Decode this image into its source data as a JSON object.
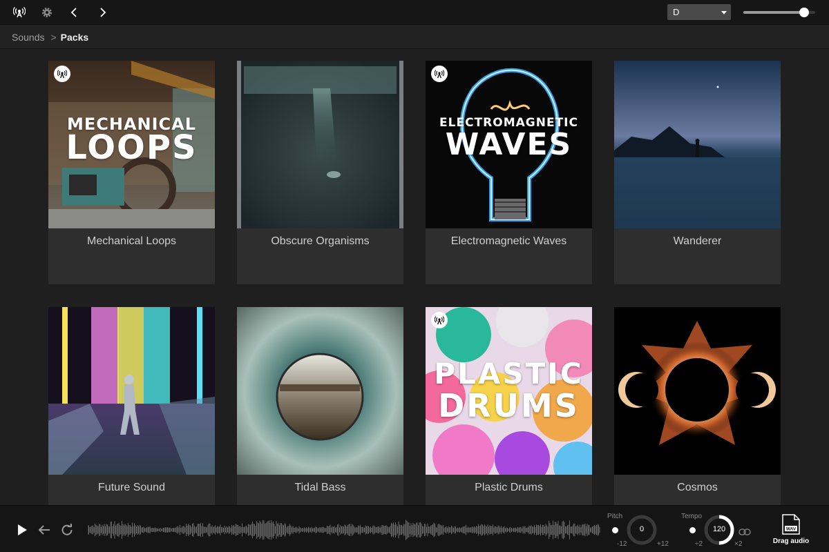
{
  "topbar": {
    "icons": [
      "broadcast-icon",
      "gear-icon",
      "chevron-left-icon",
      "chevron-right-icon"
    ],
    "key_value": "D",
    "volume": 0.85
  },
  "breadcrumb": {
    "root": "Sounds",
    "separator": ">",
    "current": "Packs"
  },
  "packs": [
    {
      "title": "Mechanical Loops",
      "art_line1": "MECHANICAL",
      "art_line2": "LOOPS",
      "badge": true
    },
    {
      "title": "Obscure Organisms",
      "art_line1": "",
      "art_line2": "",
      "badge": false
    },
    {
      "title": "Electromagnetic Waves",
      "art_line1": "ELECTROMAGNETIC",
      "art_line2": "WAVES",
      "badge": true
    },
    {
      "title": "Wanderer",
      "art_line1": "",
      "art_line2": "",
      "badge": false
    },
    {
      "title": "Future Sound",
      "art_line1": "",
      "art_line2": "",
      "badge": false
    },
    {
      "title": "Tidal Bass",
      "art_line1": "",
      "art_line2": "",
      "badge": false
    },
    {
      "title": "Plastic Drums",
      "art_line1": "PLASTIC",
      "art_line2": "DRUMS",
      "badge": true
    },
    {
      "title": "Cosmos",
      "art_line1": "",
      "art_line2": "",
      "badge": false
    }
  ],
  "player": {
    "pitch": {
      "label": "Pitch",
      "value": "0",
      "min": "-12",
      "max": "+12"
    },
    "tempo": {
      "label": "Tempo",
      "value": "120",
      "min": "÷2",
      "max": "×2",
      "level": 0.5
    },
    "file_type": "WAV",
    "drag_label": "Drag audio"
  },
  "colors": {
    "background": "#1f1f1f",
    "card": "#2e2e2e",
    "bar": "#151515",
    "accent": "#ffffff"
  }
}
